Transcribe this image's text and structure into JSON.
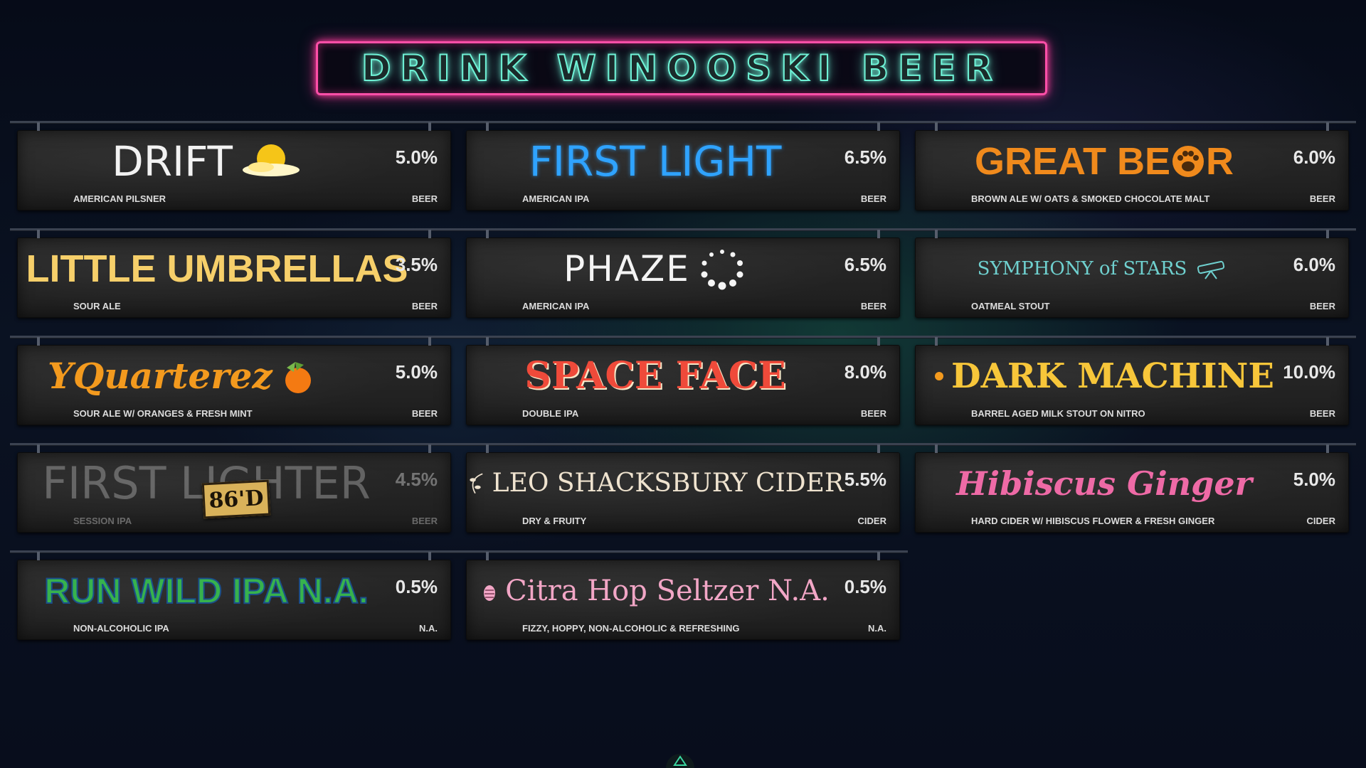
{
  "header": {
    "title": "DRINK WINOOSKI BEER"
  },
  "beers": [
    {
      "name": "DRIFT",
      "abv": "5.0%",
      "style": "AMERICAN PILSNER",
      "type": "BEER",
      "icon": "sun-cloud-icon",
      "color": "#f2f2f2",
      "status": ""
    },
    {
      "name": "FIRST LIGHT",
      "abv": "6.5%",
      "style": "AMERICAN IPA",
      "type": "BEER",
      "icon": "",
      "color": "#2fa3ff",
      "status": ""
    },
    {
      "name": "GREAT BE",
      "name2": "R",
      "abv": "6.0%",
      "style": "BROWN ALE W/ OATS & SMOKED CHOCOLATE MALT",
      "type": "BEER",
      "icon": "paw-icon",
      "color": "#f08a1c",
      "status": ""
    },
    {
      "name": "LITTLE UMBRELLAS",
      "abv": "3.5%",
      "style": "SOUR ALE",
      "type": "BEER",
      "icon": "",
      "color": "#f6cf6a",
      "status": ""
    },
    {
      "name": "PHAZE",
      "abv": "6.5%",
      "style": "AMERICAN IPA",
      "type": "BEER",
      "icon": "dot-ring-icon",
      "color": "#f4f4f4",
      "status": ""
    },
    {
      "name": "SYMPHONY of STARS",
      "abv": "6.0%",
      "style": "OATMEAL STOUT",
      "type": "BEER",
      "icon": "telescope-icon",
      "color": "#6fd0cf",
      "status": ""
    },
    {
      "name": "YQuarterez",
      "abv": "5.0%",
      "style": "SOUR ALE W/ ORANGES & FRESH MINT",
      "type": "BEER",
      "icon": "orange-icon",
      "color": "#f39a1e",
      "status": ""
    },
    {
      "name": "SPACE FACE",
      "abv": "8.0%",
      "style": "DOUBLE IPA",
      "type": "BEER",
      "icon": "",
      "color": "#ef4a3a",
      "status": ""
    },
    {
      "name": "DARK MACHINE",
      "abv": "10.0%",
      "style": "BARREL AGED MILK STOUT ON NITRO",
      "type": "BEER",
      "icon": "gear-dot-icon",
      "color": "#f7c63a",
      "status": ""
    },
    {
      "name": "FIRST LIGHTER",
      "abv": "4.5%",
      "style": "SESSION IPA",
      "type": "BEER",
      "icon": "",
      "color": "#bdbdbd",
      "status": "86'D"
    },
    {
      "name": "LEO SHACKSBURY CIDER",
      "abv": "5.5%",
      "style": "DRY & FRUITY",
      "type": "CIDER",
      "icon": "vine-icon",
      "color": "#efe3cf",
      "status": ""
    },
    {
      "name": "Hibiscus Ginger",
      "abv": "5.0%",
      "style": "HARD CIDER W/ HIBISCUS FLOWER & FRESH GINGER",
      "type": "CIDER",
      "icon": "",
      "color": "#ee6aa6",
      "status": ""
    },
    {
      "name": "RUN WILD IPA N.A.",
      "abv": "0.5%",
      "style": "NON-ALCOHOLIC IPA",
      "type": "N.A.",
      "icon": "",
      "color": "#37b24d",
      "status": ""
    },
    {
      "name": "Citra Hop Seltzer N.A.",
      "abv": "0.5%",
      "style": "FIZZY, HOPPY, NON-ALCOHOLIC & REFRESHING",
      "type": "N.A.",
      "icon": "hop-icon",
      "color": "#f2a6c6",
      "status": ""
    }
  ]
}
